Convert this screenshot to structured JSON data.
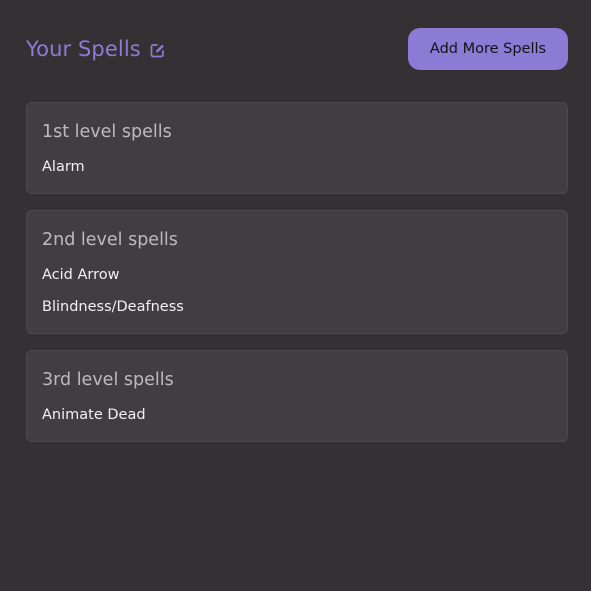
{
  "header": {
    "title": "Your Spells",
    "edit_icon": "edit-icon",
    "add_button_label": "Add More Spells"
  },
  "colors": {
    "background": "#333134",
    "accent": "#8a7bd4",
    "card": "#403e41"
  },
  "levels": [
    {
      "title": "1st level spells",
      "spells": [
        "Alarm"
      ]
    },
    {
      "title": "2nd level spells",
      "spells": [
        "Acid Arrow",
        "Blindness/Deafness"
      ]
    },
    {
      "title": "3rd level spells",
      "spells": [
        "Animate Dead"
      ]
    }
  ]
}
